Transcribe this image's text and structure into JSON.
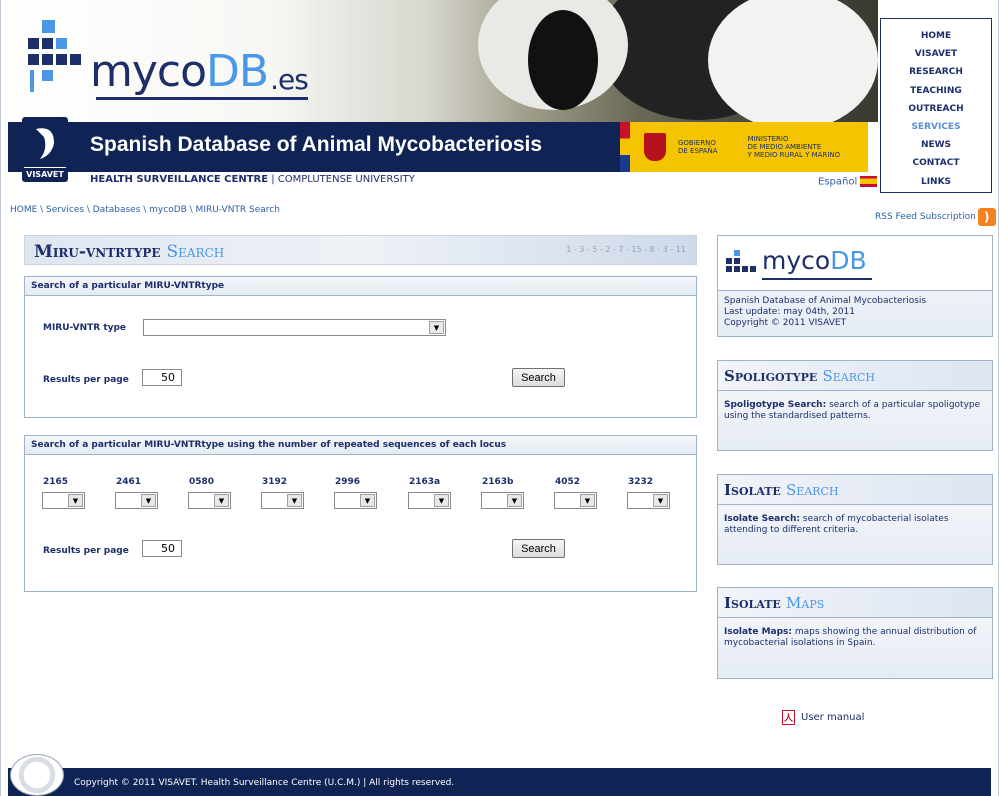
{
  "header": {
    "logo_prefix": "myco",
    "logo_db": "DB",
    "logo_suffix": ".es",
    "band_title": "Spanish Database of Animal Mycobacteriosis",
    "centre_bold": "HEALTH SURVEILLANCE CENTRE",
    "centre_rest": " | COMPLUTENSE UNIVERSITY",
    "gov_line1": "GOBIERNO",
    "gov_line2": "DE ESPAÑA",
    "min_line1": "MINISTERIO",
    "min_line2": "DE MEDIO AMBIENTE",
    "min_line3": "Y MEDIO RURAL Y MARINO",
    "language": "Español",
    "visavet_logo": "VISAVET"
  },
  "nav": {
    "items": [
      "HOME",
      "VISAVET",
      "RESEARCH",
      "TEACHING",
      "OUTREACH",
      "SERVICES",
      "NEWS",
      "CONTACT",
      "LINKS"
    ],
    "active": "SERVICES"
  },
  "breadcrumb": "HOME \\ Services \\ Databases \\ mycoDB \\ MIRU-VNTR Search",
  "rss": "RSS Feed Subscription",
  "page": {
    "title_dark": "Miru-vntrtype ",
    "title_light": "Search",
    "loci_order": "1 - 3 - 5 - 2 - 7 - 15 - 8 - 3 - 11"
  },
  "box1": {
    "header": "Search of a particular MIRU-VNTRtype",
    "type_label": "MIRU-VNTR type",
    "type_value": "",
    "results_label": "Results per page",
    "results_value": "50",
    "search_label": "Search"
  },
  "box2": {
    "header": "Search of a particular MIRU-VNTRtype using the number of repeated sequences of each locus",
    "loci": [
      "2165",
      "2461",
      "0580",
      "3192",
      "2996",
      "2163a",
      "2163b",
      "4052",
      "3232"
    ],
    "results_label": "Results per page",
    "results_value": "50",
    "search_label": "Search"
  },
  "side": {
    "mycodb_prefix": "myco",
    "mycodb_db": "DB",
    "mycodb_line1": "Spanish Database of Animal Mycobacteriosis",
    "mycodb_line2": "Last update: may 04th, 2011",
    "mycodb_line3": "Copyright © 2011 VISAVET",
    "spoligo_dark": "Spoligotype ",
    "spoligo_light": "Search",
    "spoligo_bold": "Spoligotype Search:",
    "spoligo_text": " search of a particular spoligotype using the standardised patterns.",
    "isolate_dark": "Isolate ",
    "isolate_light": "Search",
    "isolate_bold": "Isolate Search:",
    "isolate_text": " search of mycobacterial isolates attending to different criteria.",
    "maps_dark": "Isolate ",
    "maps_light": "Maps",
    "maps_bold": "Isolate Maps:",
    "maps_text": " maps showing the annual distribution of mycobacterial isolations in Spain.",
    "manual": "User manual"
  },
  "footer": "Copyright © 2011 VISAVET. Health Surveillance Centre (U.C.M.) | All rights reserved.",
  "colors": {
    "navy": "#0f2454",
    "accent": "#4a97e8",
    "nav_active": "#5a8ed8"
  }
}
